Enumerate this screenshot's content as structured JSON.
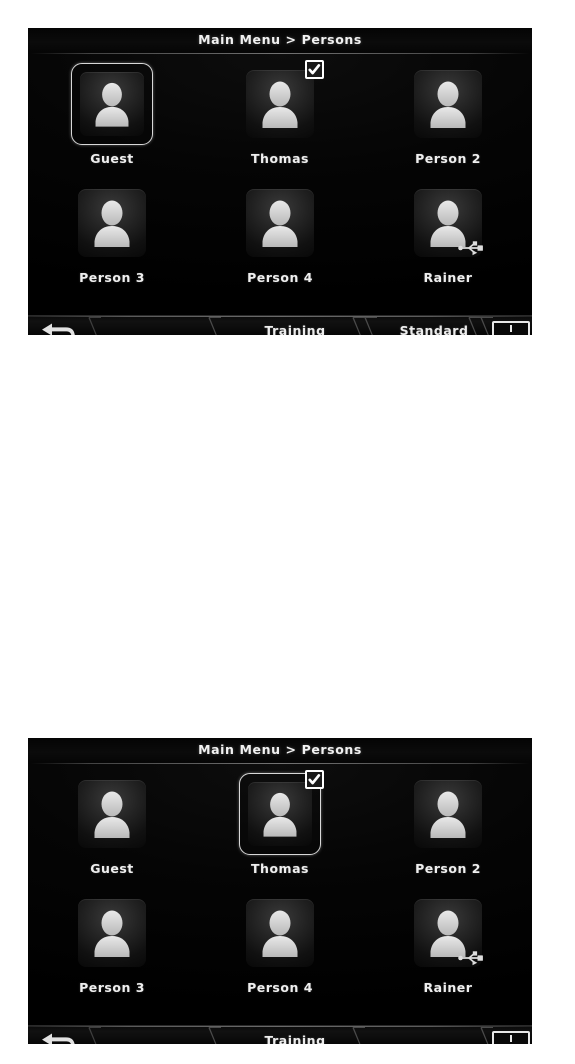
{
  "page": {
    "background": "#ffffff",
    "device_background": "#000000",
    "accent_text": "#efefef"
  },
  "panels": [
    {
      "id": "panel-1",
      "header": {
        "title": "Main Menu > Persons"
      },
      "persons": [
        {
          "label": "Guest",
          "selected": true,
          "checked": false,
          "usb": false,
          "icon": "person-avatar-icon"
        },
        {
          "label": "Thomas",
          "selected": false,
          "checked": true,
          "usb": false,
          "icon": "person-avatar-icon"
        },
        {
          "label": "Person 2",
          "selected": false,
          "checked": false,
          "usb": false,
          "icon": "person-avatar-icon"
        },
        {
          "label": "Person 3",
          "selected": false,
          "checked": false,
          "usb": false,
          "icon": "person-avatar-icon"
        },
        {
          "label": "Person 4",
          "selected": false,
          "checked": false,
          "usb": false,
          "icon": "person-avatar-icon"
        },
        {
          "label": "Rainer",
          "selected": false,
          "checked": false,
          "usb": true,
          "icon": "person-avatar-icon"
        }
      ],
      "bottombar": {
        "back_icon": "back-arrow-icon",
        "tab_training": "Training",
        "tab_standard": "Standard",
        "info_icon": "info-icon"
      }
    },
    {
      "id": "panel-2",
      "header": {
        "title": "Main Menu > Persons"
      },
      "persons": [
        {
          "label": "Guest",
          "selected": false,
          "checked": false,
          "usb": false,
          "icon": "person-avatar-icon"
        },
        {
          "label": "Thomas",
          "selected": true,
          "checked": true,
          "usb": false,
          "icon": "person-avatar-icon"
        },
        {
          "label": "Person 2",
          "selected": false,
          "checked": false,
          "usb": false,
          "icon": "person-avatar-icon"
        },
        {
          "label": "Person 3",
          "selected": false,
          "checked": false,
          "usb": false,
          "icon": "person-avatar-icon"
        },
        {
          "label": "Person 4",
          "selected": false,
          "checked": false,
          "usb": false,
          "icon": "person-avatar-icon"
        },
        {
          "label": "Rainer",
          "selected": false,
          "checked": false,
          "usb": true,
          "icon": "person-avatar-icon"
        }
      ],
      "bottombar": {
        "back_icon": "back-arrow-icon",
        "tab_training": "Training",
        "tab_standard": "",
        "info_icon": "info-icon"
      }
    }
  ]
}
